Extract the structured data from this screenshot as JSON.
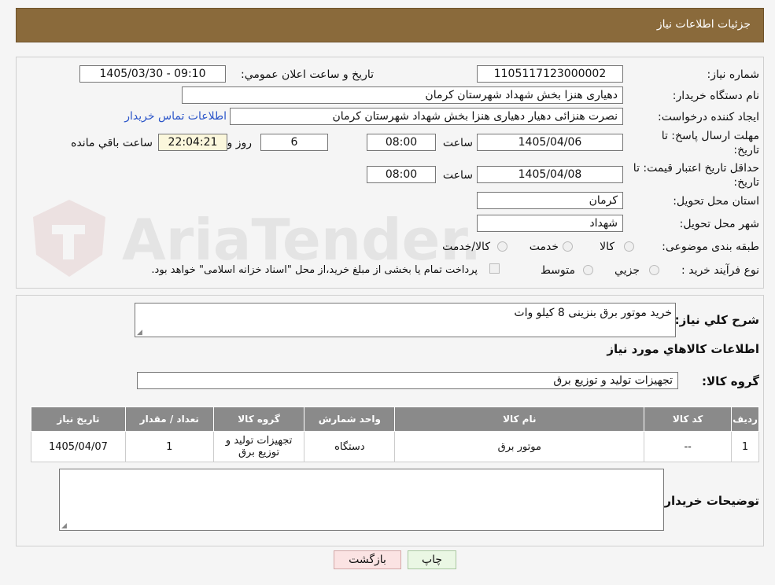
{
  "header": {
    "title": "جزئیات اطلاعات نیاز"
  },
  "form": {
    "need_number_label": "شماره نیاز:",
    "need_number": "1105117123000002",
    "announce_label": "تاریخ و ساعت اعلان عمومي:",
    "announce_value": "1405/03/30 - 09:10",
    "buyer_org_label": "نام دستگاه خریدار:",
    "buyer_org": "دهیاری هنزا بخش شهداد شهرستان کرمان",
    "creator_label": "ایجاد کننده درخواست:",
    "creator": "نصرت هنزائی دهیار دهیاری هنزا بخش شهداد شهرستان کرمان",
    "contact_link": "اطلاعات تماس خریدار",
    "deadline_label_1": "مهلت ارسال پاسخ: تا",
    "deadline_label_2": "تاریخ:",
    "deadline_date": "1405/04/06",
    "time_label": "ساعت",
    "deadline_time": "08:00",
    "days_value": "6",
    "days_label": "روز و",
    "remaining_time": "22:04:21",
    "remaining_label": "ساعت باقي مانده",
    "validity_label_1": "حداقل تاریخ اعتبار قیمت: تا",
    "validity_label_2": "تاریخ:",
    "validity_date": "1405/04/08",
    "validity_time": "08:00",
    "province_label": "استان محل تحویل:",
    "province": "کرمان",
    "city_label": "شهر محل تحویل:",
    "city": "شهداد",
    "category_label": "طبقه بندی موضوعی:",
    "category_options": [
      "کالا",
      "خدمت",
      "کالا/خدمت"
    ],
    "process_label": "نوع فرآیند خرید :",
    "process_options": [
      "جزيي",
      "متوسط"
    ],
    "payment_note": "پرداخت تمام یا بخشی از مبلغ خرید،از محل \"اسناد خزانه اسلامی\" خواهد بود."
  },
  "description": {
    "label": "شرح کلي نياز:",
    "value": "خرید موتور برق بنزینی 8 کیلو وات",
    "goods_info_title": "اطلاعات کالاهاي مورد نياز",
    "goods_group_label": "گروه کالا:",
    "goods_group": "تجهیزات تولید و توزیع برق"
  },
  "table": {
    "headers": [
      "رديف",
      "کد کالا",
      "نام کالا",
      "واحد شمارش",
      "گروه کالا",
      "تعداد / مقدار",
      "تاریخ نیاز"
    ],
    "rows": [
      [
        "1",
        "--",
        "موتور برق",
        "دستگاه",
        "تجهیزات تولید و توزیع برق",
        "1",
        "1405/04/07"
      ]
    ]
  },
  "buyer_notes": {
    "label": "توضیحات خریدار:",
    "value": ""
  },
  "buttons": {
    "print": "چاپ",
    "back": "بازگشت"
  },
  "watermark": {
    "text": "AriaTender.neT"
  }
}
